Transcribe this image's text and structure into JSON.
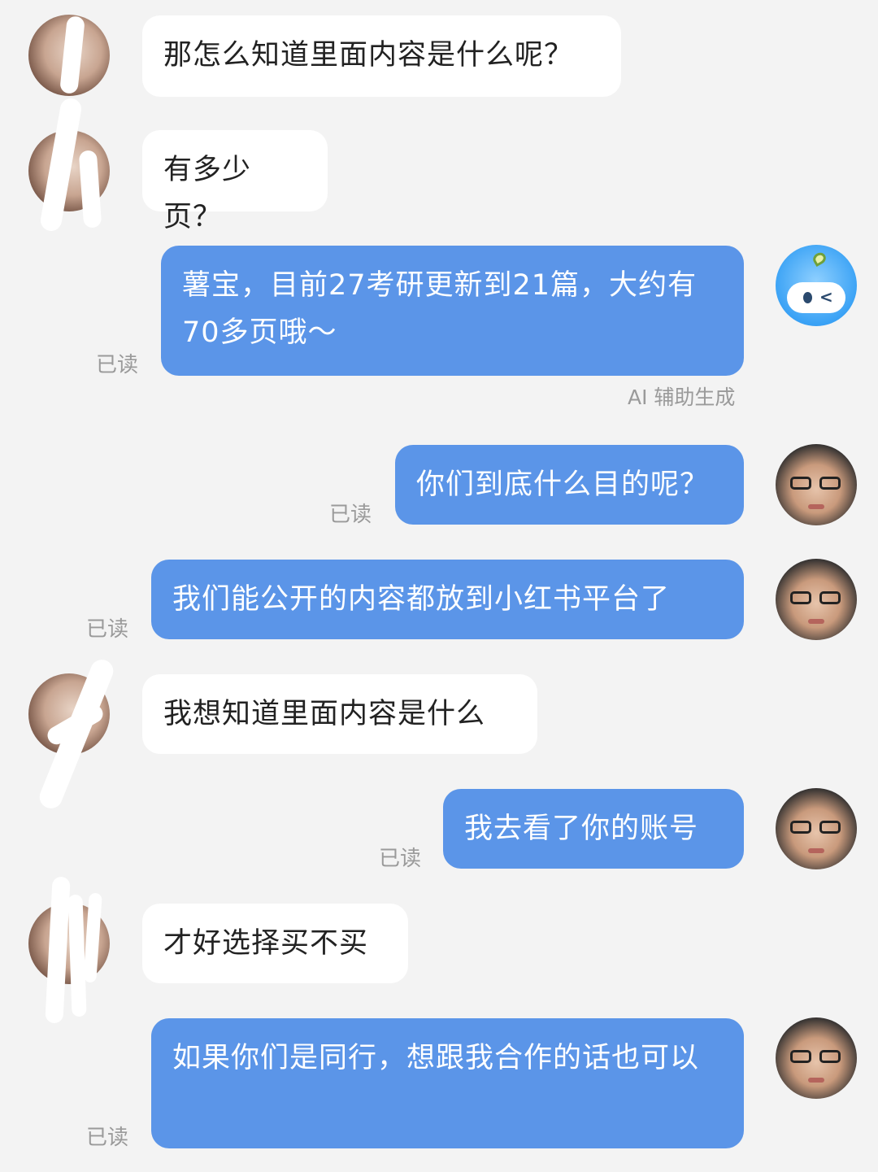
{
  "messages": [
    {
      "side": "left",
      "text": "那怎么知道里面内容是什么呢？"
    },
    {
      "side": "left",
      "text": "有多少页？"
    },
    {
      "side": "right",
      "text": "薯宝，目前27考研更新到21篇，大约有70多页哦～",
      "status": "已读",
      "note": "AI 辅助生成",
      "avatar": "bot-avatar"
    },
    {
      "side": "right",
      "text": "你们到底什么目的呢？",
      "status": "已读"
    },
    {
      "side": "right",
      "text": "我们能公开的内容都放到小红书平台了",
      "status": "已读"
    },
    {
      "side": "left",
      "text": "我想知道里面内容是什么"
    },
    {
      "side": "right",
      "text": "我去看了你的账号",
      "status": "已读"
    },
    {
      "side": "left",
      "text": "才好选择买不买"
    },
    {
      "side": "right",
      "text": "如果你们是同行，想跟我合作的话也可以",
      "status": "已读"
    }
  ],
  "colors": {
    "background": "#f3f3f3",
    "outgoing_bubble": "#5b95e8",
    "incoming_bubble": "#ffffff",
    "status_text": "#9a9a9a"
  },
  "icons": {
    "bot_avatar": "robot-mascot-icon",
    "user_avatar": "person-photo",
    "contact_avatar": "person-photo-redacted"
  }
}
